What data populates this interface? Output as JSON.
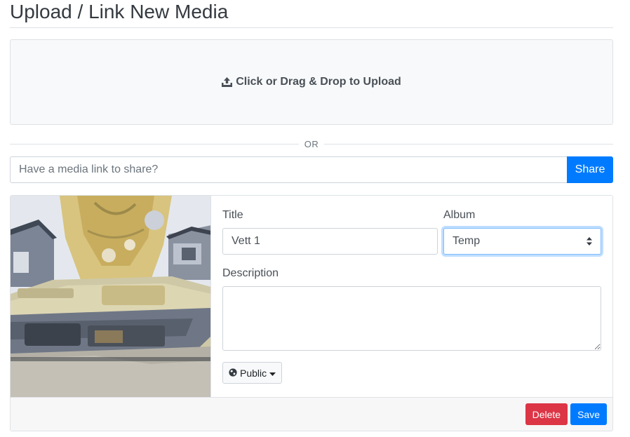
{
  "page": {
    "title": "Upload / Link New Media"
  },
  "upload": {
    "label": "Click or Drag & Drop to Upload",
    "icon": "upload-icon"
  },
  "divider": {
    "text": "OR"
  },
  "link": {
    "placeholder": "Have a media link to share?",
    "share_label": "Share"
  },
  "media": {
    "thumbnail": "car-photo",
    "title_label": "Title",
    "title_value": "Vett 1",
    "album_label": "Album",
    "album_value": "Temp",
    "description_label": "Description",
    "description_value": "",
    "visibility_label": "Public",
    "visibility_icon": "globe-icon",
    "delete_label": "Delete",
    "save_label": "Save"
  },
  "colors": {
    "primary": "#007bff",
    "danger": "#dc3545",
    "muted": "#6c757d",
    "border": "#dee2e6"
  }
}
